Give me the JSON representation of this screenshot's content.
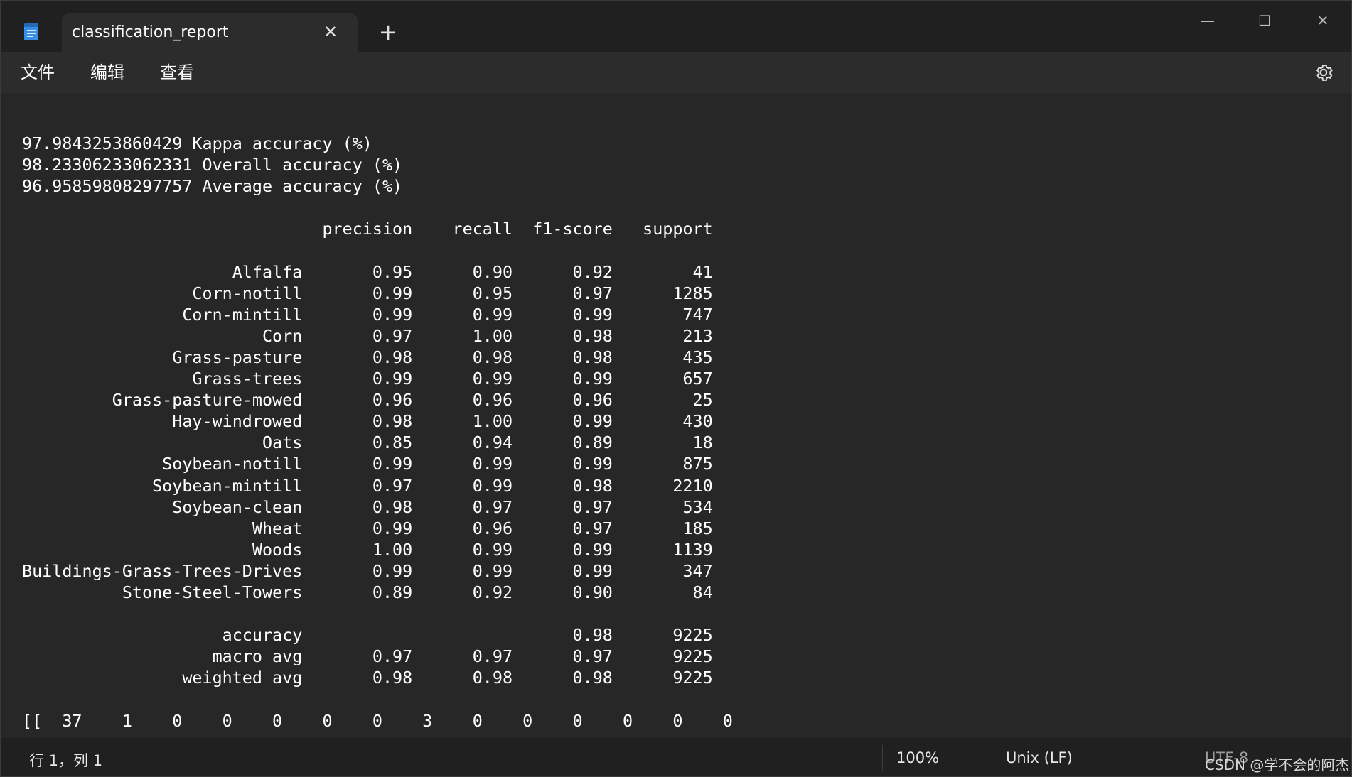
{
  "tab": {
    "title": "classification_report",
    "close_glyph": "✕",
    "new_tab_glyph": "+"
  },
  "window_controls": {
    "minimize": "—",
    "maximize": "☐",
    "close": "✕"
  },
  "menu": {
    "file": "文件",
    "edit": "编辑",
    "view": "查看"
  },
  "icons": {
    "app": "notepad-icon",
    "settings": "gear-icon"
  },
  "document": {
    "content": "97.9843253860429 Kappa accuracy (%)\n98.23306233062331 Overall accuracy (%)\n96.95859808297757 Average accuracy (%)\n\n                              precision    recall  f1-score   support\n\n                     Alfalfa       0.95      0.90      0.92        41\n                 Corn-notill       0.99      0.95      0.97      1285\n                Corn-mintill       0.99      0.99      0.99       747\n                        Corn       0.97      1.00      0.98       213\n               Grass-pasture       0.98      0.98      0.98       435\n                 Grass-trees       0.99      0.99      0.99       657\n         Grass-pasture-mowed       0.96      0.96      0.96        25\n               Hay-windrowed       0.98      1.00      0.99       430\n                        Oats       0.85      0.94      0.89        18\n              Soybean-notill       0.99      0.99      0.99       875\n             Soybean-mintill       0.97      0.99      0.98      2210\n               Soybean-clean       0.98      0.97      0.97       534\n                       Wheat       0.99      0.96      0.97       185\n                       Woods       1.00      0.99      0.99      1139\nBuildings-Grass-Trees-Drives       0.99      0.99      0.99       347\n          Stone-Steel-Towers       0.89      0.92      0.90        84\n\n                    accuracy                           0.98      9225\n                   macro avg       0.97      0.97      0.97      9225\n                weighted avg       0.98      0.98      0.98      9225\n\n[[  37    1    0    0    0    0    0    3    0    0    0    0    0    0"
  },
  "statusbar": {
    "position": "行 1，列 1",
    "zoom": "100%",
    "line_ending": "Unix (LF)",
    "encoding": "UTF-8",
    "watermark": "CSDN @学不会的阿杰"
  }
}
